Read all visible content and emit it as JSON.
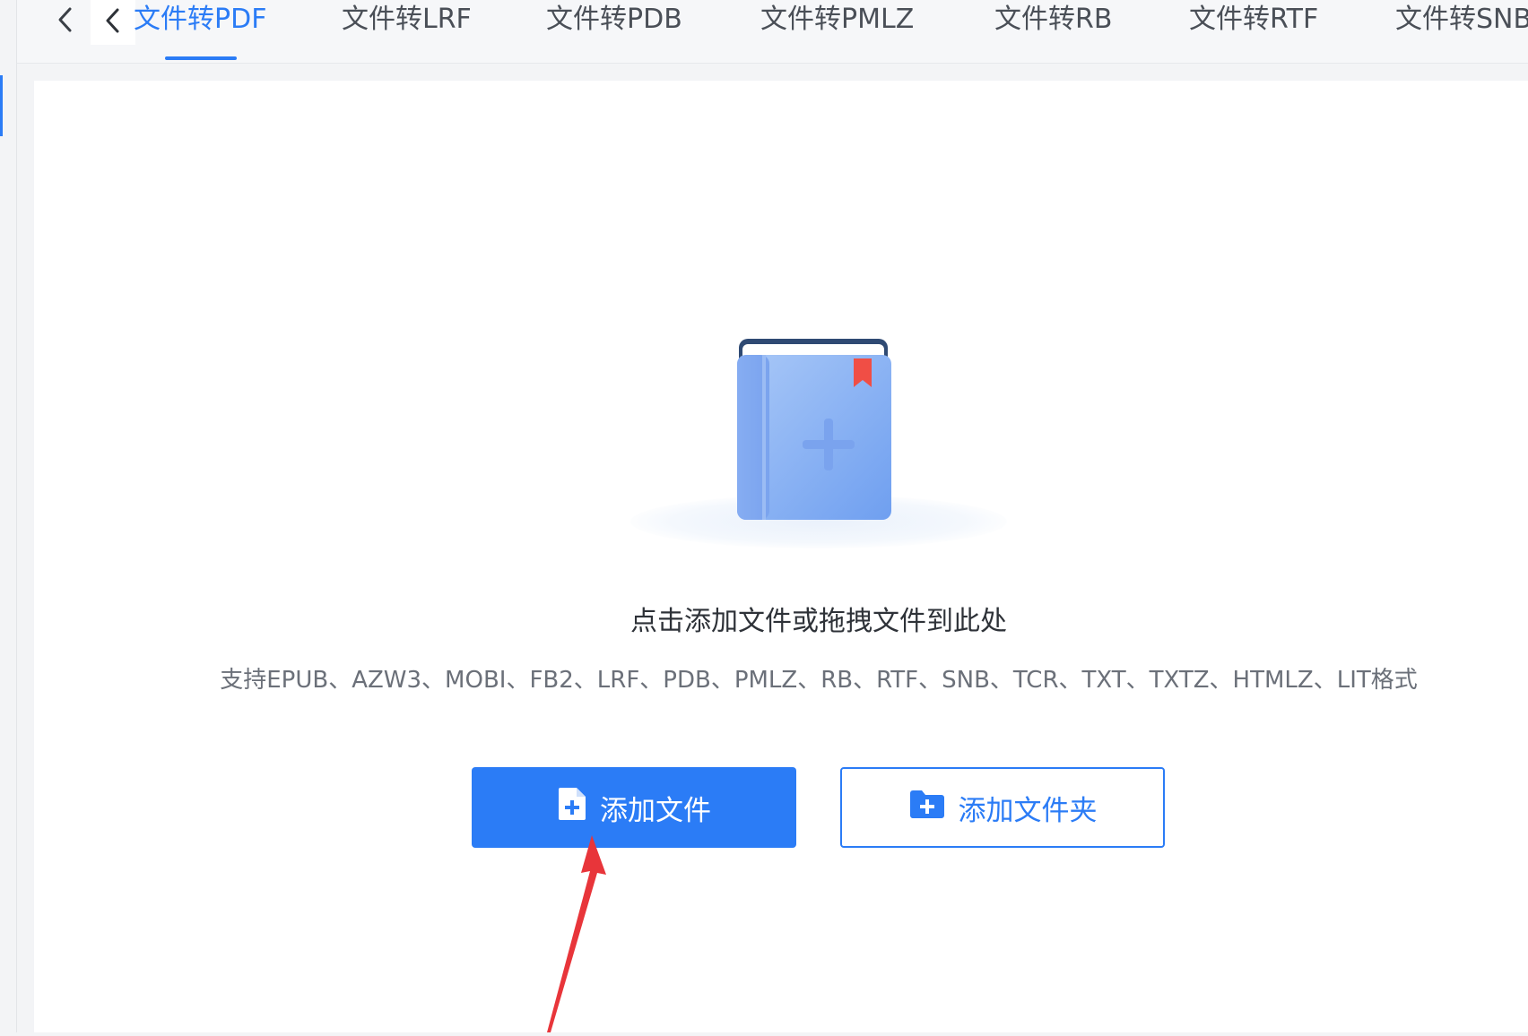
{
  "tabs": [
    {
      "label": "文件转PDF",
      "active": true
    },
    {
      "label": "文件转LRF",
      "active": false
    },
    {
      "label": "文件转PDB",
      "active": false
    },
    {
      "label": "文件转PMLZ",
      "active": false
    },
    {
      "label": "文件转RB",
      "active": false
    },
    {
      "label": "文件转RTF",
      "active": false
    },
    {
      "label": "文件转SNB",
      "active": false
    }
  ],
  "nav": {
    "back_icon": "chevron-left-icon",
    "tabs_scroll_left_icon": "chevron-left-icon"
  },
  "upload": {
    "hint": "点击添加文件或拖拽文件到此处",
    "formats": "支持EPUB、AZW3、MOBI、FB2、LRF、PDB、PMLZ、RB、RTF、SNB、TCR、TXT、TXTZ、HTMLZ、LIT格式",
    "illustration_icon": "book-add-icon"
  },
  "buttons": {
    "add_file": {
      "label": "添加文件",
      "icon": "file-plus-icon"
    },
    "add_folder": {
      "label": "添加文件夹",
      "icon": "folder-plus-icon"
    }
  },
  "annotation": {
    "icon": "red-arrow-icon",
    "color": "#e8353a"
  },
  "colors": {
    "accent": "#2b7cf6",
    "text": "#2e3238",
    "muted": "#6b7079",
    "bookmark": "#f04e45"
  }
}
